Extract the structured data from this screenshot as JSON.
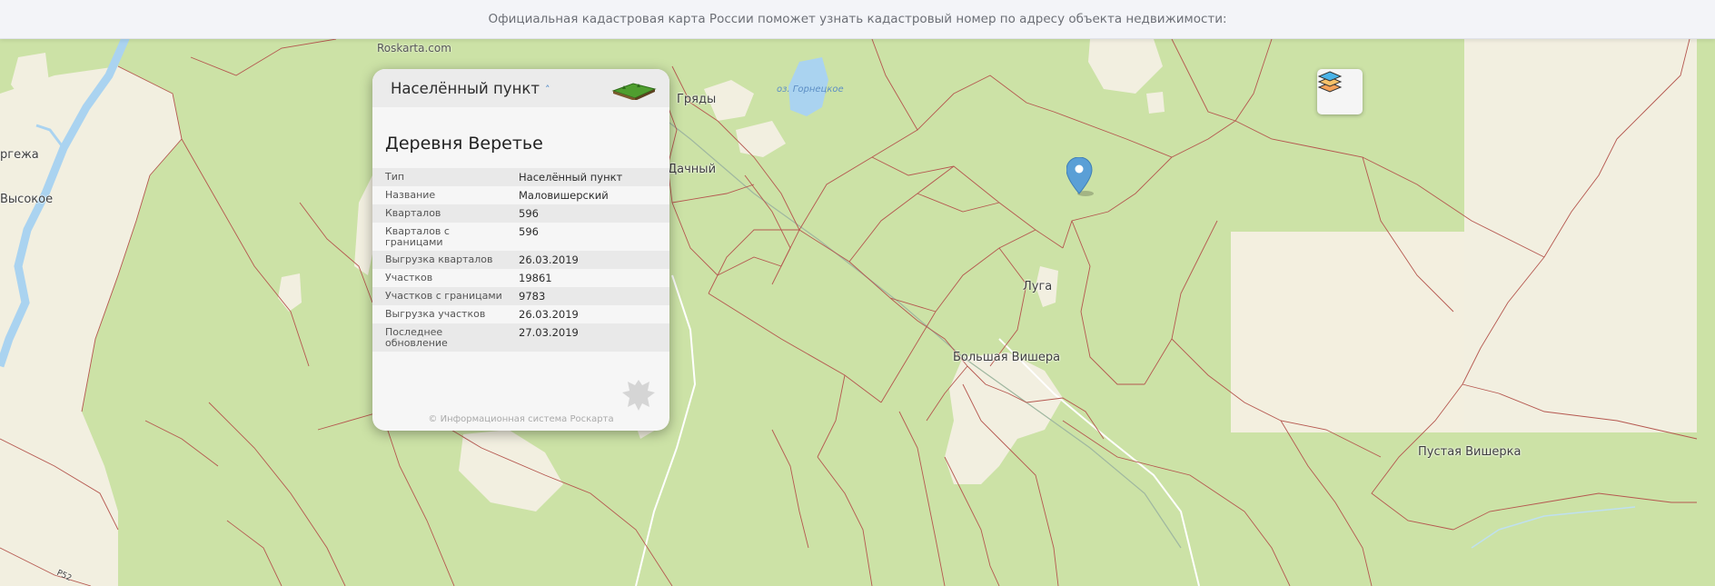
{
  "header": {
    "notice": "Официальная кадастровая карта России поможет узнать кадастровый номер по адресу объекта недвижимости:"
  },
  "map": {
    "credit": "Roskarta.com",
    "places": [
      {
        "id": "gryady",
        "label": "Гряды"
      },
      {
        "id": "dachny",
        "label": "Дачный"
      },
      {
        "id": "orgezha",
        "label": "ргежа"
      },
      {
        "id": "vysokoe",
        "label": "Высокое"
      },
      {
        "id": "luga",
        "label": "Луга"
      },
      {
        "id": "bolshaya-vishera",
        "label": "Большая Вишера"
      },
      {
        "id": "pustaya-visherka",
        "label": "Пустая Вишерка"
      }
    ],
    "water_labels": [
      {
        "id": "lake",
        "label": "оз. Горнецкое"
      }
    ],
    "road_label": "Р52",
    "colors": {
      "forest": "#cce2a6",
      "open_land": "#f2efe0",
      "water": "#aad3f0",
      "boundary": "#b5574f"
    }
  },
  "controls": {
    "layers_icon": "layers-icon"
  },
  "popup": {
    "kind": "Населённый пункт",
    "title": "Деревня Веретье",
    "rows": [
      {
        "key": "Тип",
        "value": "Населённый пункт"
      },
      {
        "key": "Название",
        "value": "Маловишерский"
      },
      {
        "key": "Кварталов",
        "value": "596"
      },
      {
        "key": "Кварталов с границами",
        "value": "596"
      },
      {
        "key": "Выгрузка кварталов",
        "value": "26.03.2019"
      },
      {
        "key": "Участков",
        "value": "19861"
      },
      {
        "key": "Участков с границами",
        "value": "9783"
      },
      {
        "key": "Выгрузка участков",
        "value": "26.03.2019"
      },
      {
        "key": "Последнее обновление",
        "value": "27.03.2019"
      }
    ],
    "footer": "© Информационная система Роскарта"
  }
}
